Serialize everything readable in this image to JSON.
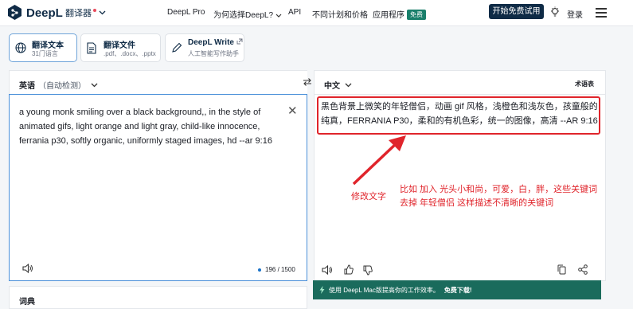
{
  "brand": {
    "name": "DeepL"
  },
  "topbar": {
    "translator": "翻译器",
    "nav": [
      "DeepL Pro",
      "为何选择DeepL?",
      "API",
      "不同计划和价格",
      "应用程序"
    ],
    "free_badge": "免费",
    "cta": "开始免费试用",
    "login": "登录"
  },
  "modes": [
    {
      "title": "翻译文本",
      "subtitle": "31门语言",
      "icon": "globe-icon"
    },
    {
      "title": "翻译文件",
      "subtitle": ".pdf、.docx、.pptx",
      "icon": "document-icon"
    },
    {
      "title": "DeepL Write",
      "subtitle": "人工智能写作助手",
      "icon": "pen-icon"
    }
  ],
  "source": {
    "language": "英语",
    "language_note": "（自动检测）",
    "text": "a young monk smiling over a black background,, in the style of animated gifs, light orange and light gray, child-like innocence, ferrania p30, softly organic, uniformly staged images, hd --ar 9:16",
    "char_count": "196 / 1500"
  },
  "target": {
    "language": "中文",
    "glossary": "术语表",
    "text": "黑色背景上微笑的年轻僧侣，动画 gif 风格，浅橙色和浅灰色，孩童般的纯真，FERRANIA P30，柔和的有机色彩，统一的图像，高清 --AR 9:16"
  },
  "annotation": {
    "label": "修改文字",
    "note_line1": "比如 加入 光头小和尚，可爱，白，胖，这些关键词",
    "note_line2": "去掉 年轻僧侣 这样描述不清晰的关键词",
    "color": "#e0242b"
  },
  "dictionary": {
    "label": "词典"
  },
  "promo": {
    "text": "使用 DeepL Mac版提高你的工作效率。",
    "action": "免费下载!"
  },
  "colors": {
    "brand_navy": "#0f2b46",
    "focus_blue": "#4a90d9",
    "promo_green": "#1a6b5c"
  }
}
